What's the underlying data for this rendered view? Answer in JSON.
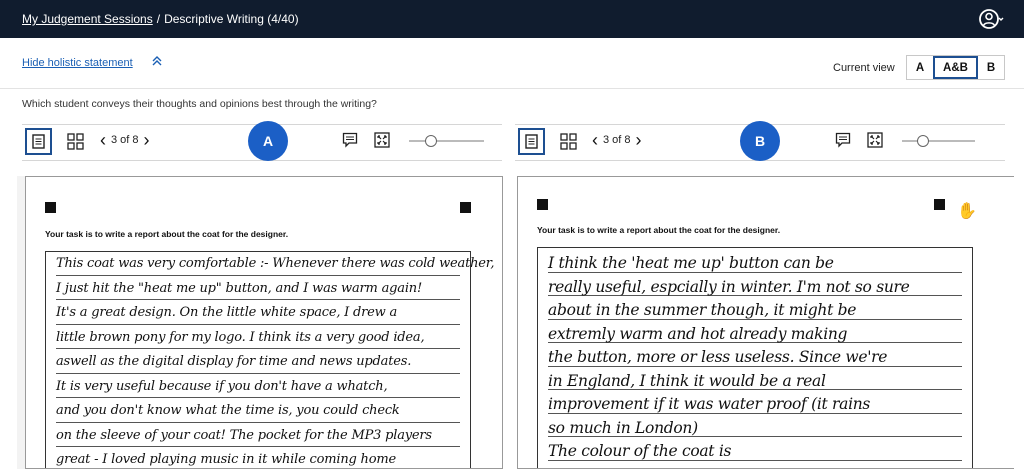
{
  "header": {
    "breadcrumb_link": "My Judgement Sessions",
    "breadcrumb_sep": "/",
    "breadcrumb_current": "Descriptive Writing (4/40)",
    "avatar_icon": "user-circle-icon"
  },
  "holistic": {
    "label": "Hide holistic statement",
    "icon": "chevron-up-double-icon"
  },
  "view": {
    "label": "Current view",
    "options": [
      "A",
      "A&B",
      "B"
    ],
    "selected": "A&B"
  },
  "question": "Which student conveys their thoughts and opinions best through the writing?",
  "panels": {
    "left": {
      "badge": "A",
      "pager_text": "3 of 8",
      "zoom_level": 0.25,
      "task": "Your task is to write a report about the coat for the designer.",
      "lines": [
        "This coat was very comfortable :- Whenever there was cold weather,",
        "I just hit the \"heat me up\" button, and I was warm again!",
        "It's a great design. On the little white space, I drew a",
        "little brown pony for my logo. I think its a very good idea,",
        "aswell as the digital display for time and news updates.",
        "It is very useful because if you don't have a whatch,",
        "and you don't know what the time is, you could check",
        "on the sleeve of your coat! The pocket for the MP3 players",
        "great - I loved playing music in it while coming home"
      ]
    },
    "right": {
      "badge": "B",
      "pager_text": "3 of 8",
      "zoom_level": 0.25,
      "task": "Your task is to write a report about the coat for the designer.",
      "lines": [
        "I think the 'heat me up' button can be",
        "really useful, espcially in winter. I'm not so sure",
        "about in the summer though, it might be",
        "extremly warm and hot already making",
        "the button, more or less useless. Since we're",
        "in England, I think it would be a real",
        "improvement if it was water proof (it rains",
        "so much in London)",
        "The colour of the coat is"
      ]
    }
  },
  "colors": {
    "topbar": "#101c2e",
    "accent": "#1b5fc6",
    "link": "#1a5fb4",
    "selected_border": "#1d4f91"
  }
}
